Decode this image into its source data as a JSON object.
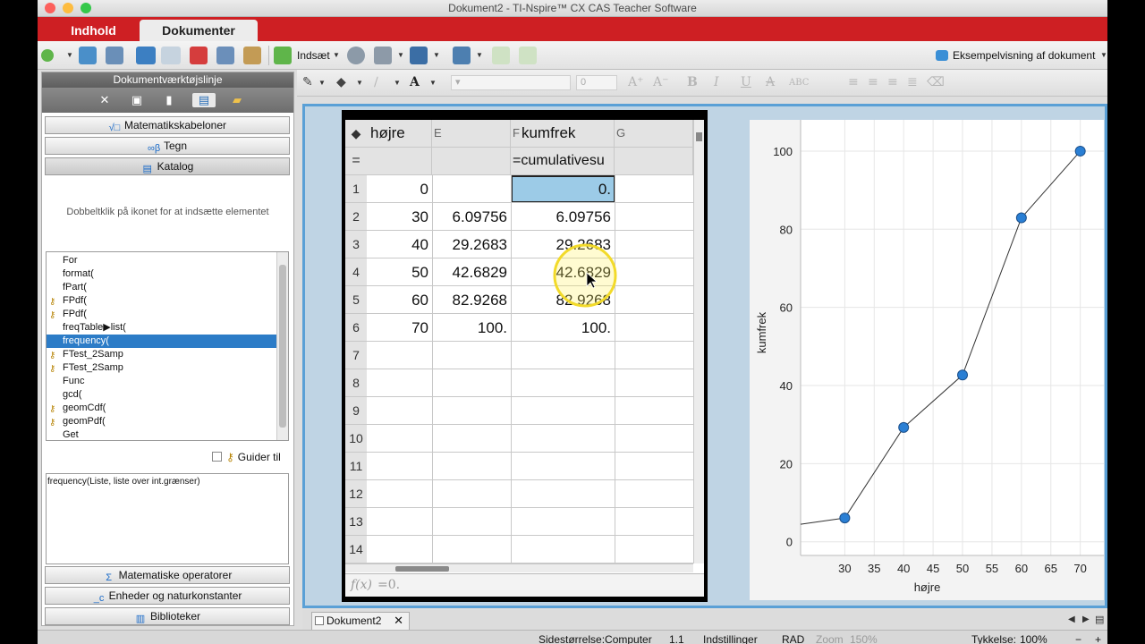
{
  "window": {
    "title": "Dokument2 - TI-Nspire™ CX CAS Teacher Software"
  },
  "main_tabs": [
    {
      "label": "Indhold"
    },
    {
      "label": "Dokumenter"
    }
  ],
  "toolbar": {
    "insert_label": "Indsæt",
    "preview_label": "Eksempelvisning af dokument",
    "font_size_value": "0"
  },
  "left_panel": {
    "title": "Dokumentværktøjslinje",
    "sections_top": [
      "Matematikskabeloner",
      "Tegn",
      "Katalog"
    ],
    "hint": "Dobbeltklik på ikonet for at indsætte elementet",
    "catalog_items": [
      {
        "label": "For",
        "key": false,
        "selected": false
      },
      {
        "label": "format(",
        "key": false,
        "selected": false
      },
      {
        "label": "fPart(",
        "key": false,
        "selected": false
      },
      {
        "label": "FPdf(",
        "key": true,
        "selected": false
      },
      {
        "label": "FPdf(",
        "key": true,
        "selected": false
      },
      {
        "label": "freqTable▶list(",
        "key": false,
        "selected": false
      },
      {
        "label": "frequency(",
        "key": false,
        "selected": true
      },
      {
        "label": "FTest_2Samp",
        "key": true,
        "selected": false
      },
      {
        "label": "FTest_2Samp",
        "key": true,
        "selected": false
      },
      {
        "label": "Func",
        "key": false,
        "selected": false
      },
      {
        "label": "gcd(",
        "key": false,
        "selected": false
      },
      {
        "label": "geomCdf(",
        "key": true,
        "selected": false
      },
      {
        "label": "geomPdf(",
        "key": true,
        "selected": false
      },
      {
        "label": "Get",
        "key": false,
        "selected": false
      }
    ],
    "guide_label": "Guider til",
    "syntax_text": "frequency(Liste, liste over int.grænser)",
    "sections_bottom": [
      "Matematiske operatorer",
      "Enheder og naturkonstanter",
      "Biblioteker"
    ]
  },
  "spreadsheet": {
    "columns": [
      {
        "letter": "",
        "name": "højre",
        "formula": ""
      },
      {
        "letter": "E",
        "name": "",
        "formula": ""
      },
      {
        "letter": "F",
        "name": "kumfrek",
        "formula": "=cumulativesu"
      },
      {
        "letter": "G",
        "name": "",
        "formula": ""
      }
    ],
    "formula_row_label": "=",
    "row_labels": [
      "1",
      "2",
      "3",
      "4",
      "5",
      "6",
      "7",
      "8",
      "9",
      "10",
      "11",
      "12",
      "13",
      "14"
    ],
    "rows": [
      [
        "0",
        "",
        "0."
      ],
      [
        "30",
        "6.09756",
        "6.09756"
      ],
      [
        "40",
        "29.2683",
        "29.2683"
      ],
      [
        "50",
        "42.6829",
        "42.6829"
      ],
      [
        "60",
        "82.9268",
        "82.9268"
      ],
      [
        "70",
        "100.",
        "100."
      ]
    ],
    "entry_line": {
      "fx_label": "f(x)",
      "value": "=0."
    }
  },
  "chart_data": {
    "type": "line",
    "x": [
      30,
      40,
      50,
      60,
      70
    ],
    "y": [
      6.09756,
      29.2683,
      42.6829,
      82.9268,
      100
    ],
    "title": "",
    "xlabel": "højre",
    "ylabel": "kumfrek",
    "xlim": [
      22.5,
      74
    ],
    "ylim": [
      -3.5,
      108
    ],
    "xticks": [
      30,
      35,
      40,
      45,
      50,
      55,
      60,
      65,
      70
    ],
    "yticks": [
      0,
      20,
      40,
      60,
      80,
      100
    ],
    "grid": true,
    "point_color": "#2a7fd4"
  },
  "doc_tabs": [
    {
      "label": "Dokument2"
    }
  ],
  "statusbar": {
    "page_size": "Sidestørrelse:Computer",
    "page_num": "1.1",
    "settings": "Indstillinger",
    "angle_mode": "RAD",
    "zoom_label": "Zoom",
    "zoom_value": "150%",
    "thickness_label": "Tykkelse:",
    "thickness_value": "100%"
  },
  "colors": {
    "accent_red": "#ce1f23",
    "selection_blue": "#2c7cc7",
    "cell_selected": "#9ccbe7",
    "page_border": "#5aa0d6"
  }
}
